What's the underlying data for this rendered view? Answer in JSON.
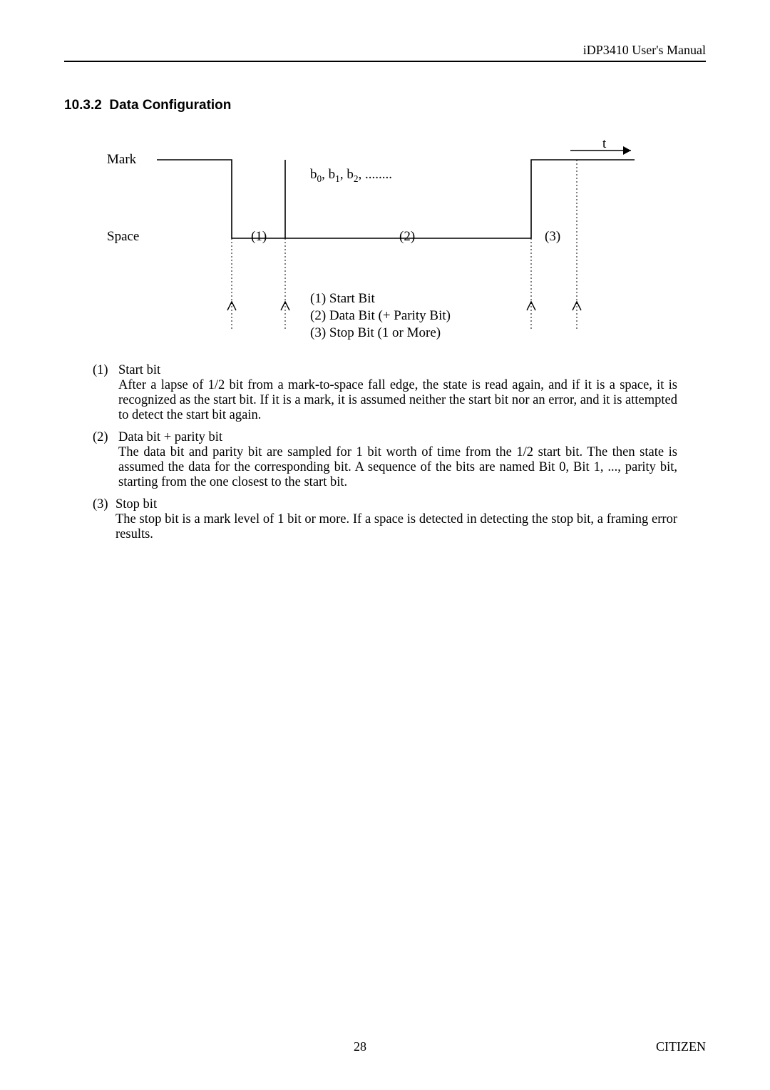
{
  "chart_data": {
    "type": "timing-diagram",
    "levels": [
      "Mark",
      "Space"
    ],
    "segments": [
      {
        "id": "(1)",
        "label": "Start Bit"
      },
      {
        "id": "(2)",
        "label": "Data Bit (+ Parity Bit)",
        "bits": "b0, b1, b2, ........"
      },
      {
        "id": "(3)",
        "label": "Stop Bit (1 or More)"
      }
    ],
    "time_axis_label": "t"
  },
  "header": {
    "right": "iDP3410 User's Manual"
  },
  "section": {
    "number": "10.3.2",
    "title": "Data Configuration"
  },
  "diagram": {
    "level_high": "Mark",
    "level_low": "Space",
    "time_label": "t",
    "bits_label_html": "b<span class=\"sub\">0</span>, b<span class=\"sub\">1</span>, b<span class=\"sub\">2</span>, ........",
    "seg1": "(1)",
    "seg2": "(2)",
    "seg3": "(3)",
    "legend1": "(1) Start Bit",
    "legend2": "(2) Data Bit (+ Parity Bit)",
    "legend3": "(3) Stop Bit (1 or More)"
  },
  "items": [
    {
      "num": "(1)",
      "title": "Start bit",
      "body": "After a lapse of 1/2 bit from a mark-to-space fall edge, the state is read again, and if it is a space, it is recognized as the start bit.  If it is a mark, it is assumed neither the start bit nor an error, and it is attempted to detect the start bit again."
    },
    {
      "num": "(2)",
      "title": "Data bit + parity bit",
      "body": "The data bit and parity bit are sampled for 1 bit worth of time from the 1/2 start bit.  The then state is assumed the data for the corresponding bit.  A sequence of the bits are named Bit 0, Bit 1, ..., parity bit, starting from the one closest to the start bit."
    },
    {
      "num": "(3)",
      "title": "Stop bit",
      "body": "The stop bit is a mark level of 1 bit or more.  If a space is detected in detecting the stop bit, a framing error results."
    }
  ],
  "footer": {
    "page": "28",
    "brand": "CITIZEN"
  }
}
